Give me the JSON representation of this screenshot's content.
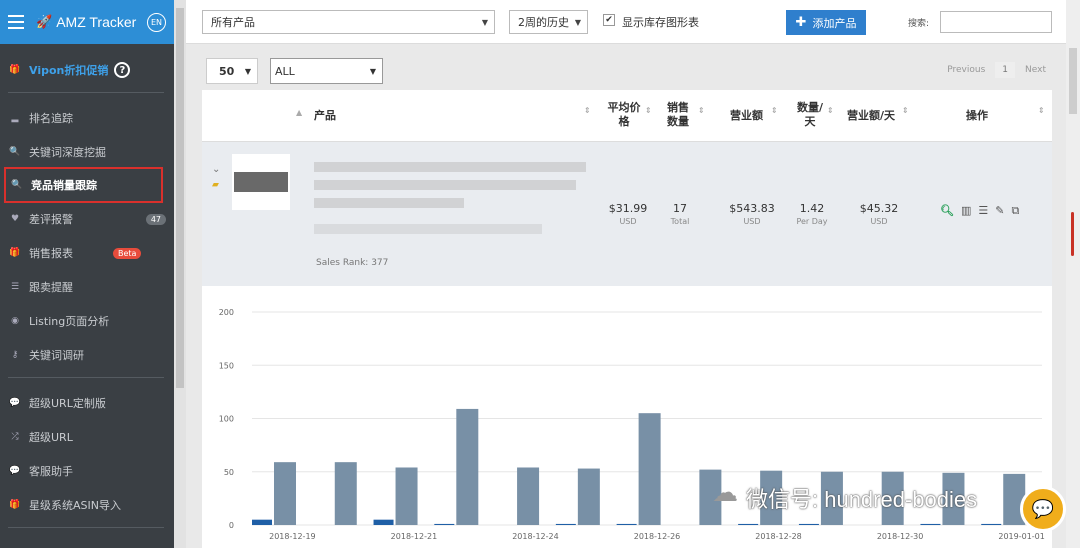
{
  "sidebar": {
    "brand": "AMZ Tracker",
    "lang": "EN",
    "vipon": "Vipon折扣促销",
    "items": [
      {
        "label": "排名追踪",
        "icon": "signal-icon"
      },
      {
        "label": "关键词深度挖掘",
        "icon": "search-icon"
      },
      {
        "label": "竞品销量跟踪",
        "icon": "search-icon",
        "active": true
      },
      {
        "label": "差评报警",
        "icon": "heart-icon",
        "count": "47"
      },
      {
        "label": "销售报表",
        "icon": "gift-icon",
        "badge": "Beta"
      },
      {
        "label": "跟卖提醒",
        "icon": "list-icon"
      },
      {
        "label": "Listing页面分析",
        "icon": "eye-icon"
      },
      {
        "label": "关键词调研",
        "icon": "key-icon"
      },
      {
        "label": "超级URL定制版",
        "icon": "chat-icon"
      },
      {
        "label": "超级URL",
        "icon": "shuffle-icon"
      },
      {
        "label": "客服助手",
        "icon": "chat-icon"
      },
      {
        "label": "星级系统ASIN导入",
        "icon": "gift-icon"
      }
    ]
  },
  "topbar": {
    "product_select": "所有产品",
    "history_select": "2周的历史",
    "show_inventory": "显示库存图形表",
    "add_product": "添加产品",
    "search_label": "搜索:"
  },
  "list": {
    "per_page": "50",
    "filter": "ALL",
    "prev": "Previous",
    "page": "1",
    "next": "Next"
  },
  "table": {
    "headers": {
      "product": "产品",
      "avg_price": "平均价格",
      "sales_qty": "销售数量",
      "revenue": "营业额",
      "qty_day": "数量/天",
      "revenue_day": "营业额/天",
      "actions": "操作"
    },
    "row": {
      "sales_rank": "Sales Rank: 377",
      "avg_price": "$31.99",
      "avg_price_sub": "USD",
      "sales_qty": "17",
      "sales_qty_sub": "Total",
      "revenue": "$543.83",
      "revenue_sub": "USD",
      "qty_day": "1.42",
      "qty_day_sub": "Per Day",
      "revenue_day": "$45.32",
      "revenue_day_sub": "USD"
    }
  },
  "watermark": "微信号: hundred-bodies",
  "chart_data": {
    "type": "bar",
    "y_ticks": [
      0,
      50,
      100,
      150,
      200
    ],
    "ylim": [
      0,
      200
    ],
    "x_tick_labels": [
      "2018-12-19",
      "2018-12-21",
      "2018-12-24",
      "2018-12-26",
      "2018-12-28",
      "2018-12-30",
      "2019-01-01"
    ],
    "colors": {
      "primary": "#1f5fa6",
      "secondary": "#7890a6"
    },
    "groups": [
      {
        "primary": 5,
        "secondary": 59
      },
      {
        "primary": 0,
        "secondary": 59
      },
      {
        "primary": 5,
        "secondary": 54
      },
      {
        "primary": 1,
        "secondary": 109
      },
      {
        "primary": 0,
        "secondary": 54
      },
      {
        "primary": 1,
        "secondary": 53
      },
      {
        "primary": 1,
        "secondary": 105
      },
      {
        "primary": 0,
        "secondary": 52
      },
      {
        "primary": 1,
        "secondary": 51
      },
      {
        "primary": 1,
        "secondary": 50
      },
      {
        "primary": 0,
        "secondary": 50
      },
      {
        "primary": 1,
        "secondary": 49
      },
      {
        "primary": 1,
        "secondary": 48
      }
    ]
  }
}
